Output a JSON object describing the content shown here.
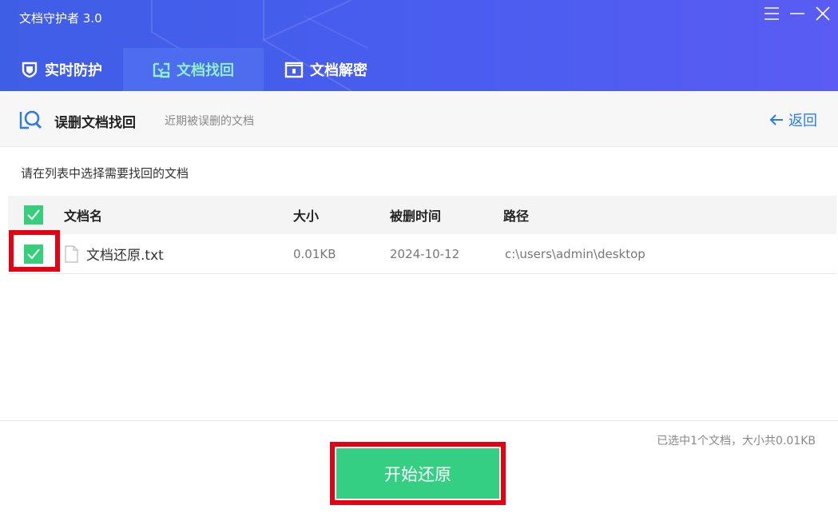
{
  "app": {
    "title": "文档守护者 3.0"
  },
  "window_controls": {
    "menu_icon": "hamburger-icon",
    "minimize_icon": "minimize-icon",
    "close_icon": "close-icon"
  },
  "tabs": [
    {
      "label": "实时防护",
      "icon": "shield-icon",
      "active": false
    },
    {
      "label": "文档找回",
      "icon": "document-recover-icon",
      "active": true
    },
    {
      "label": "文档解密",
      "icon": "folder-lock-icon",
      "active": false
    }
  ],
  "subheader": {
    "title": "误删文档找回",
    "description": "近期被误删的文档",
    "back_label": "返回"
  },
  "instruction": "请在列表中选择需要找回的文档",
  "table": {
    "columns": [
      "文档名",
      "大小",
      "被删时间",
      "路径"
    ],
    "rows": [
      {
        "name": "文档还原.txt",
        "size": "0.01KB",
        "deleted_time": "2024-10-12",
        "path": "c:\\users\\admin\\desktop",
        "checked": true
      }
    ],
    "header_checked": true
  },
  "summary": "已选中1个文档，大小共0.01KB",
  "restore_button": "开始还原",
  "colors": {
    "header_blue": "#4a5df0",
    "accent_green": "#34cf83",
    "link_blue": "#2a7de8",
    "highlight_red": "#e60012"
  }
}
